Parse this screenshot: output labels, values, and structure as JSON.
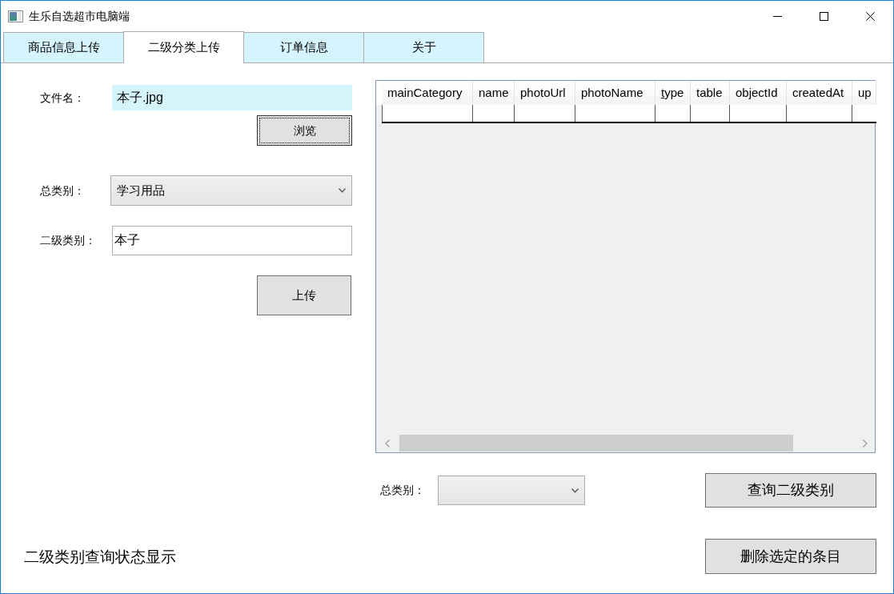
{
  "window": {
    "title": "生乐自选超市电脑端"
  },
  "tabs": [
    {
      "label": "商品信息上传",
      "selected": false
    },
    {
      "label": "二级分类上传",
      "selected": true
    },
    {
      "label": "订单信息",
      "selected": false
    },
    {
      "label": "关于",
      "selected": false
    }
  ],
  "upload_form": {
    "file_name": {
      "label": "文件名：",
      "value": "本子.jpg"
    },
    "browse_button": {
      "label": "浏览",
      "focused": true
    },
    "main_category": {
      "label": "总类别：",
      "value": "学习用品"
    },
    "sub_category": {
      "label": "二级类别：",
      "value": "本子"
    },
    "upload_button": {
      "label": "上传",
      "focused": false
    }
  },
  "table": {
    "columns": [
      {
        "label": "mainCategory",
        "mnemonic": false
      },
      {
        "label": "name",
        "mnemonic": false
      },
      {
        "label": "photoUrl",
        "mnemonic": false
      },
      {
        "label": "photoName",
        "mnemonic": false
      },
      {
        "label": "type",
        "mnemonic": true
      },
      {
        "label": "table",
        "mnemonic": false
      },
      {
        "label": "objectId",
        "mnemonic": false
      },
      {
        "label": "createdAt",
        "mnemonic": false
      },
      {
        "label": "up",
        "mnemonic": false
      }
    ]
  },
  "query": {
    "main_category": {
      "label": "总类别："
    },
    "query_button": {
      "label": "查询二级类别",
      "focused": false
    }
  },
  "status_text": "二级类别查询状态显示",
  "delete_button": {
    "label": "删除选定的条目",
    "focused": false
  }
}
